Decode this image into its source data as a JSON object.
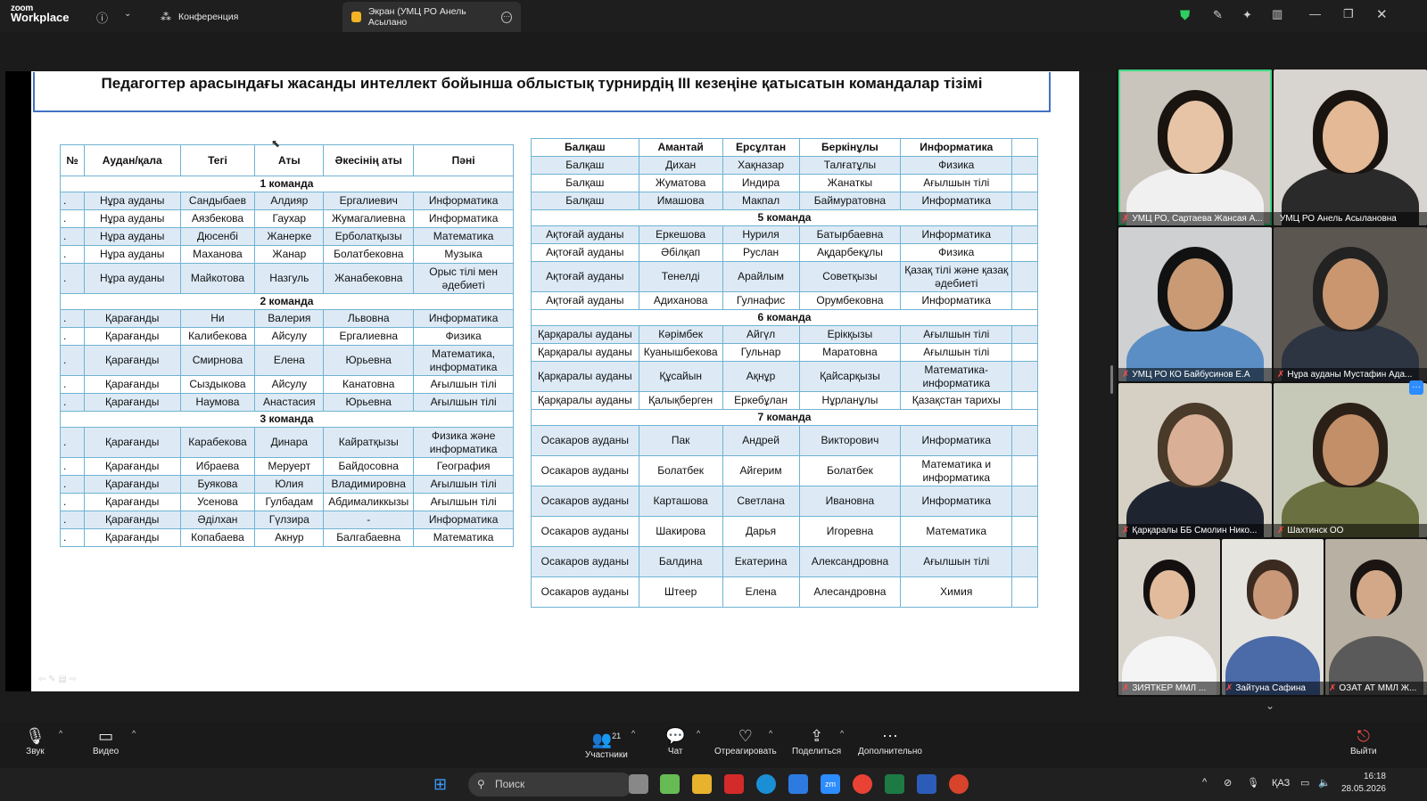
{
  "titlebar": {
    "logo_line1": "zoom",
    "logo_line2": "Workplace",
    "tab1": "Конференция",
    "tab2": "Экран (УМЦ РО Анель Асылано"
  },
  "slide": {
    "title": "Педагогтер арасындағы жасанды интеллект бойынша облыстық турнирдің ІІІ кезеңіне қатысатын командалар тізімі",
    "left_headers": [
      "№",
      "Аудан/қала",
      "Тегі",
      "Аты",
      "Әкесінің аты",
      "Пәні"
    ],
    "left_rows": [
      {
        "team": "1 команда"
      },
      {
        "cells": [
          ".",
          "Нұра ауданы",
          "Сандыбаев",
          "Алдияр",
          "Ергалиевич",
          "Информатика"
        ]
      },
      {
        "cells": [
          ".",
          "Нұра ауданы",
          "Аязбекова",
          "Гаухар",
          "Жумагалиевна",
          "Информатика"
        ]
      },
      {
        "cells": [
          ".",
          "Нұра ауданы",
          "Дюсенбі",
          "Жанерке",
          "Ерболатқызы",
          "Математика"
        ]
      },
      {
        "cells": [
          ".",
          "Нұра ауданы",
          "Маханова",
          "Жанар",
          "Болатбековна",
          "Музыка"
        ]
      },
      {
        "cells": [
          ".",
          "Нұра ауданы",
          "Майкотова",
          "Назгуль",
          "Жанабековна",
          "Орыс тілі мен әдебиеті"
        ]
      },
      {
        "team": "2 команда"
      },
      {
        "cells": [
          ".",
          "Қарағанды",
          "Ни",
          "Валерия",
          "Львовна",
          "Информатика"
        ]
      },
      {
        "cells": [
          ".",
          "Қарағанды",
          "Калибекова",
          "Айсулу",
          "Ергалиевна",
          "Физика"
        ]
      },
      {
        "cells": [
          ".",
          "Қарағанды",
          "Смирнова",
          "Елена",
          "Юрьевна",
          "Математика, информатика"
        ]
      },
      {
        "cells": [
          ".",
          "Қарағанды",
          "Сыздыкова",
          "Айсулу",
          "Канатовна",
          "Ағылшын тілі"
        ]
      },
      {
        "cells": [
          ".",
          "Қарағанды",
          "Наумова",
          "Анастасия",
          "Юрьевна",
          "Ағылшын тілі"
        ]
      },
      {
        "team": "3 команда"
      },
      {
        "cells": [
          ".",
          "Қарағанды",
          "Карабекова",
          "Динара",
          "Кайратқызы",
          "Физика және информатика"
        ]
      },
      {
        "cells": [
          ".",
          "Қарағанды",
          "Ибраева",
          "Меруерт",
          "Байдосовна",
          "География"
        ]
      },
      {
        "cells": [
          ".",
          "Қарағанды",
          "Буякова",
          "Юлия",
          "Владимировна",
          "Ағылшын тілі"
        ]
      },
      {
        "cells": [
          ".",
          "Қарағанды",
          "Усенова",
          "Гулбадам",
          "Абдималиккызы",
          "Ағылшын тілі"
        ]
      },
      {
        "cells": [
          ".",
          "Қарағанды",
          "Әділхан",
          "Гүлзира",
          "-",
          "Информатика"
        ]
      },
      {
        "cells": [
          ".",
          "Қарағанды",
          "Копабаева",
          "Акнур",
          "Балгабаевна",
          "Математика"
        ]
      }
    ],
    "right_rows": [
      {
        "cells": [
          "Балқаш",
          "Амантай",
          "Ерсұлтан",
          "Беркінұлы",
          "Информатика",
          ""
        ],
        "bold": true
      },
      {
        "cells": [
          "Балқаш",
          "Дихан",
          "Хақназар",
          "Талғатұлы",
          "Физика",
          ""
        ]
      },
      {
        "cells": [
          "Балқаш",
          "Жуматова",
          "Индира",
          "Жанаткы",
          "Ағылшын тілі",
          ""
        ]
      },
      {
        "cells": [
          "Балқаш",
          "Имашова",
          "Макпал",
          "Баймуратовна",
          "Информатика",
          ""
        ]
      },
      {
        "team": "5 команда"
      },
      {
        "cells": [
          "Ақтоғай ауданы",
          "Еркешова",
          "Нуриля",
          "Батырбаевна",
          "Информатика",
          ""
        ]
      },
      {
        "cells": [
          "Ақтоғай ауданы",
          "Әбілқап",
          "Руслан",
          "Ақдарбекұлы",
          "Физика",
          ""
        ]
      },
      {
        "cells": [
          "Ақтоғай ауданы",
          "Тенелді",
          "Арайлым",
          "Советқызы",
          "Қазақ тілі және қазақ әдебиеті",
          ""
        ]
      },
      {
        "cells": [
          "Ақтоғай ауданы",
          "Адиханова",
          "Гулнафис",
          "Орумбековна",
          "Информатика",
          ""
        ]
      },
      {
        "team": "6 команда"
      },
      {
        "cells": [
          "Қарқаралы ауданы",
          "Кәрімбек",
          "Айгүл",
          "Ерікқызы",
          "Ағылшын тілі",
          ""
        ]
      },
      {
        "cells": [
          "Қарқаралы ауданы",
          "Куанышбекова",
          "Гульнар",
          "Маратовна",
          "Ағылшын тілі",
          ""
        ]
      },
      {
        "cells": [
          "Қарқаралы ауданы",
          "Құсайын",
          "Ақнұр",
          "Қайсарқызы",
          "Математика-информатика",
          ""
        ]
      },
      {
        "cells": [
          "Қарқаралы ауданы",
          "Қалықберген",
          "Еркебұлан",
          "Нұрланұлы",
          "Қазақстан тарихы",
          ""
        ]
      },
      {
        "team": "7 команда"
      },
      {
        "cells": [
          "Осакаров ауданы",
          "Пак",
          "Андрей",
          "Викторович",
          "Информатика",
          ""
        ]
      },
      {
        "cells": [
          "Осакаров ауданы",
          "Болатбек",
          "Айгерим",
          "Болатбек",
          "Математика и информатика",
          ""
        ]
      },
      {
        "cells": [
          "Осакаров ауданы",
          "Карташова",
          "Светлана",
          "Ивановна",
          "Информатика",
          ""
        ]
      },
      {
        "cells": [
          "Осакаров ауданы",
          "Шакирова",
          "Дарья",
          "Игоревна",
          "Математика",
          ""
        ]
      },
      {
        "cells": [
          "Осакаров ауданы",
          "Балдина",
          "Екатерина",
          "Александровна",
          "Ағылшын тілі",
          ""
        ]
      },
      {
        "cells": [
          "Осакаров ауданы",
          "Штеер",
          "Елена",
          "Алесандровна",
          "Химия",
          ""
        ]
      }
    ]
  },
  "participants": [
    "УМЦ РО, Сартаева Жансая А...",
    "УМЦ РО Анель Асылановна",
    "УМЦ РО КО Байбусинов Е.А",
    "Нұра ауданы  Мустафин Ада...",
    "Қарқаралы ББ Смолин Нико...",
    "Шахтинск ОО",
    "ЗИЯТКЕР ММЛ ...",
    "Зайтуна Сафина",
    "ОЗАТ АТ ММЛ Ж..."
  ],
  "controls": {
    "audio": "Звук",
    "video": "Видео",
    "participants": "Участники",
    "participants_count": "21",
    "chat": "Чат",
    "react": "Отреагировать",
    "share": "Поделиться",
    "more": "Дополнительно",
    "leave": "Выйти"
  },
  "taskbar": {
    "search": "Поиск",
    "lang": "ҚАЗ",
    "time": "16:18",
    "date": "28.05.2026"
  },
  "colors": {
    "table_border": "#6fb3d2",
    "row_shade": "#ddeaf6",
    "title_border": "#4472c4",
    "active_speaker": "#3ddc84"
  }
}
